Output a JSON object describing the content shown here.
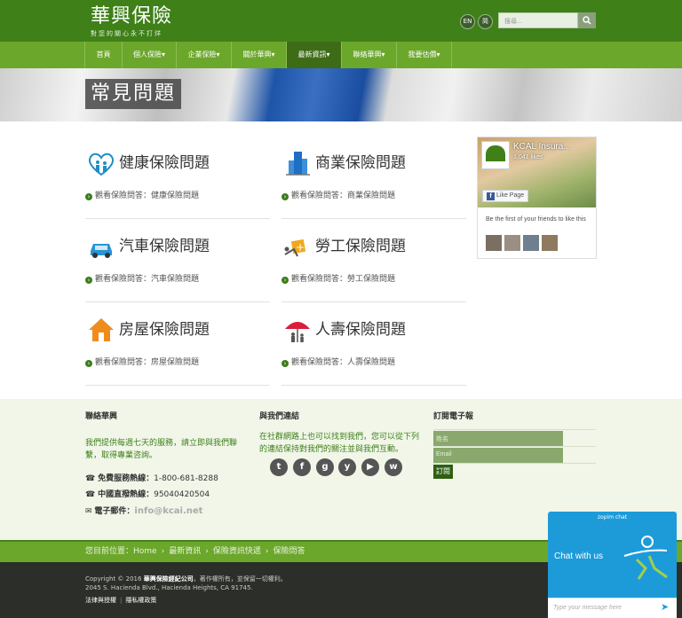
{
  "header": {
    "logo_main": "華興保險",
    "logo_sub": "對您的關心永不打烊",
    "lang_en": "EN",
    "lang_zh": "简",
    "search_placeholder": "搜尋...",
    "search_icon": "magnifier-icon"
  },
  "nav": {
    "items": [
      "首頁",
      "個人保險▾",
      "企業保險▾",
      "關於華興▾",
      "最新資訊▾",
      "聯絡華興▾",
      "我要估價▾"
    ],
    "active_index": 4
  },
  "banner": {
    "title": "常見問題"
  },
  "faq": {
    "cards": [
      {
        "title": "健康保險問題",
        "link": "觀看保險問答：健康保險問題",
        "icon": "health-heart-icon"
      },
      {
        "title": "商業保險問題",
        "link": "觀看保險問答：商業保險問題",
        "icon": "business-building-icon"
      },
      {
        "title": "汽車保險問題",
        "link": "觀看保險問答：汽車保險問題",
        "icon": "car-icon"
      },
      {
        "title": "勞工保險問題",
        "link": "觀看保險問答：勞工保險問題",
        "icon": "worker-injury-icon"
      },
      {
        "title": "房屋保險問題",
        "link": "觀看保險問答：房屋保險問題",
        "icon": "house-icon"
      },
      {
        "title": "人壽保險問題",
        "link": "觀看保險問答：人壽保險問題",
        "icon": "umbrella-family-icon"
      }
    ]
  },
  "facebook": {
    "page_name": "KCAL Insura...",
    "likes": "1,041 likes",
    "like_button": "Like Page",
    "friends_text": "Be the first of your friends to like this"
  },
  "footer": {
    "contact_heading": "聯絡華興",
    "contact_text": "我們提供每週七天的服務，請立即與我們聯繫，取得專業咨詢。",
    "toll_free_label": "免費服務熱線：",
    "toll_free_value": "1-800-681-8288",
    "china_label": "中國直撥熱線：",
    "china_value": "95040420504",
    "email_label": "電子郵件：",
    "email_value": "info@kcai.net",
    "social_heading": "與我們連結",
    "social_text": "在社群網路上也可以找到我們，您可以從下列的連結保持對我們的關注並與我們互動。",
    "social_icons": [
      {
        "name": "twitter-icon",
        "glyph": "t"
      },
      {
        "name": "facebook-icon",
        "glyph": "f"
      },
      {
        "name": "google-plus-icon",
        "glyph": "g"
      },
      {
        "name": "yelp-icon",
        "glyph": "y"
      },
      {
        "name": "youtube-icon",
        "glyph": "▶"
      },
      {
        "name": "weibo-icon",
        "glyph": "w"
      }
    ],
    "subscribe_heading": "訂閱電子報",
    "name_placeholder": "姓名",
    "email_placeholder": "Email",
    "subscribe_button": "訂閱"
  },
  "breadcrumb": {
    "prefix": "您目前位置：",
    "items": [
      "Home",
      "最新資訊",
      "保險資訊快遞",
      "保險問答"
    ]
  },
  "bottom": {
    "copyright_pre": "Copyright © 2016 ",
    "company": "華興保險經紀公司",
    "copyright_post": "，著作權所有，並保留一切權利。",
    "address": "2045 S. Hacienda Blvd., Hacienda Heights, CA 91745.",
    "legal": "法律與授權",
    "privacy": "隱私權政策"
  },
  "chat": {
    "brand": "zopim chat",
    "title": "Chat with us",
    "placeholder": "Type your message here"
  },
  "colors": {
    "header": "#3f8019",
    "nav": "#6ba72b",
    "nav_active": "#3e6b16",
    "footer_bg": "#f1f6e9",
    "bottom_bg": "#2b2e29",
    "chat": "#1d9bd9"
  }
}
